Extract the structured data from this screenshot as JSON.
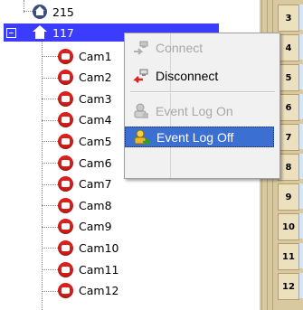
{
  "tree": {
    "site": {
      "label": "215"
    },
    "selected_site": {
      "label": "117"
    },
    "cameras": [
      "Cam1",
      "Cam2",
      "Cam3",
      "Cam4",
      "Cam5",
      "Cam6",
      "Cam7",
      "Cam8",
      "Cam9",
      "Cam10",
      "Cam11",
      "Cam12"
    ]
  },
  "grid": {
    "rows": [
      "3",
      "4",
      "5",
      "6",
      "7",
      "8",
      "9",
      "10",
      "11",
      "12"
    ]
  },
  "context_menu": {
    "items": [
      {
        "label": "Connect",
        "enabled": false,
        "icon": "connect-icon"
      },
      {
        "label": "Disconnect",
        "enabled": true,
        "icon": "disconnect-icon"
      },
      {
        "label": "Event Log On",
        "enabled": false,
        "icon": "event-log-on-icon"
      },
      {
        "label": "Event Log Off",
        "enabled": true,
        "highlighted": true,
        "icon": "event-log-off-icon"
      }
    ]
  },
  "colors": {
    "selection": "#3c3cff",
    "menu_highlight": "#3b6fd1",
    "camera_icon": "#d8201c"
  }
}
